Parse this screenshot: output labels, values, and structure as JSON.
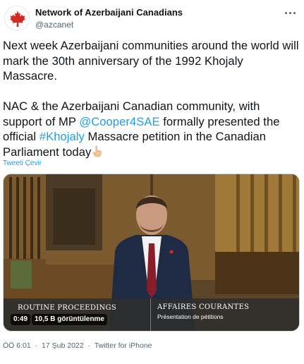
{
  "header": {
    "display_name": "Network of Azerbaijani Canadians",
    "handle": "@azcanet"
  },
  "tweet": {
    "para1": "Next week Azerbaijani communities around the world will mark the 30th anniversary of the 1992 Khojaly Massacre.",
    "para2_a": "NAC & the Azerbaijani Canadian community, with support of MP ",
    "mention": "@Cooper4SAE",
    "para2_b": " formally presented the official ",
    "hashtag": "#Khojaly",
    "para2_c": " Massacre petition in the Canadian Parliament today",
    "translate_label": "Tweeti Çevir"
  },
  "media": {
    "caption_left": "ROUTINE PROCEEDINGS",
    "caption_right": "AFFAIRES COURANTES",
    "caption_right_sub": "Présentation de pétitions",
    "duration": "0:49",
    "views": "10,5 B görüntülenme"
  },
  "meta": {
    "time": "ÖÖ 6:01",
    "separator": "·",
    "date": "17 Şub 2022",
    "source": "Twitter for iPhone"
  },
  "icons": {
    "avatar": "maple-leaf-icon",
    "more": "more-options-icon",
    "finger": "pointing-down-icon"
  },
  "colors": {
    "link": "#1d9bf0",
    "secondary": "#536471",
    "brand": "#d52b1e"
  }
}
